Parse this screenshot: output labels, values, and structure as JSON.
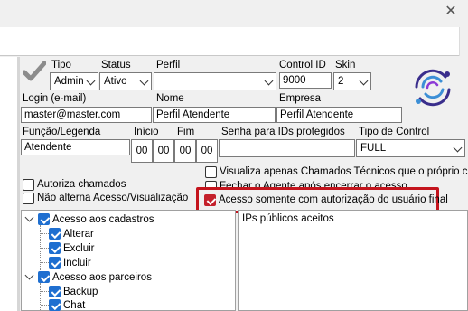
{
  "window": {
    "close_glyph": "✕"
  },
  "fields": {
    "tipo": {
      "label": "Tipo",
      "value": "Admin"
    },
    "status": {
      "label": "Status",
      "value": "Ativo"
    },
    "perfil": {
      "label": "Perfil",
      "value": ""
    },
    "control_id": {
      "label": "Control ID",
      "value": "9000"
    },
    "skin": {
      "label": "Skin",
      "value": "2"
    },
    "login": {
      "label": "Login (e-mail)",
      "value": "master@master.com"
    },
    "nome": {
      "label": "Nome",
      "value": "Perfil Atendente"
    },
    "empresa": {
      "label": "Empresa",
      "value": "Perfil Atendente"
    },
    "funcao": {
      "label": "Função/Legenda",
      "value": "Atendente"
    },
    "inicio": {
      "label": "Início",
      "hh": "00",
      "mm": "00"
    },
    "fim": {
      "label": "Fim",
      "hh": "00",
      "mm": "00"
    },
    "senha": {
      "label": "Senha para IDs protegidos",
      "value": ""
    },
    "tipo_control": {
      "label": "Tipo de Control",
      "value": "FULL"
    }
  },
  "options": {
    "autoriza_chamados": {
      "label": "Autoriza chamados",
      "checked": false
    },
    "nao_alterna": {
      "label": "Não alterna Acesso/Visualização",
      "checked": false
    },
    "visualiza_tecnicos": {
      "label": "Visualiza apenas Chamados Técnicos que o próprio criar",
      "checked": false
    },
    "fechar_agente": {
      "label": "Fechar o Agente após encerrar o acesso",
      "checked": false
    },
    "acesso_autorizacao": {
      "label": "Acesso somente com autorização do usuário final",
      "checked": true
    }
  },
  "tree": [
    {
      "label": "Acesso aos cadastros",
      "checked": true,
      "level": 0
    },
    {
      "label": "Alterar",
      "checked": true,
      "level": 1
    },
    {
      "label": "Excluir",
      "checked": true,
      "level": 1
    },
    {
      "label": "Incluir",
      "checked": true,
      "level": 1
    },
    {
      "label": "Acesso aos parceiros",
      "checked": true,
      "level": 0
    },
    {
      "label": "Backup",
      "checked": true,
      "level": 1
    },
    {
      "label": "Chat",
      "checked": true,
      "level": 1
    }
  ],
  "ips": {
    "header": "IPs públicos aceitos"
  },
  "icons": {
    "checkmark": "checkmark-icon",
    "logo": "brand-logo-icon"
  },
  "colors": {
    "highlight": "#c4141d",
    "check_blue": "#1f6fd0",
    "check_red": "#c4202b"
  }
}
